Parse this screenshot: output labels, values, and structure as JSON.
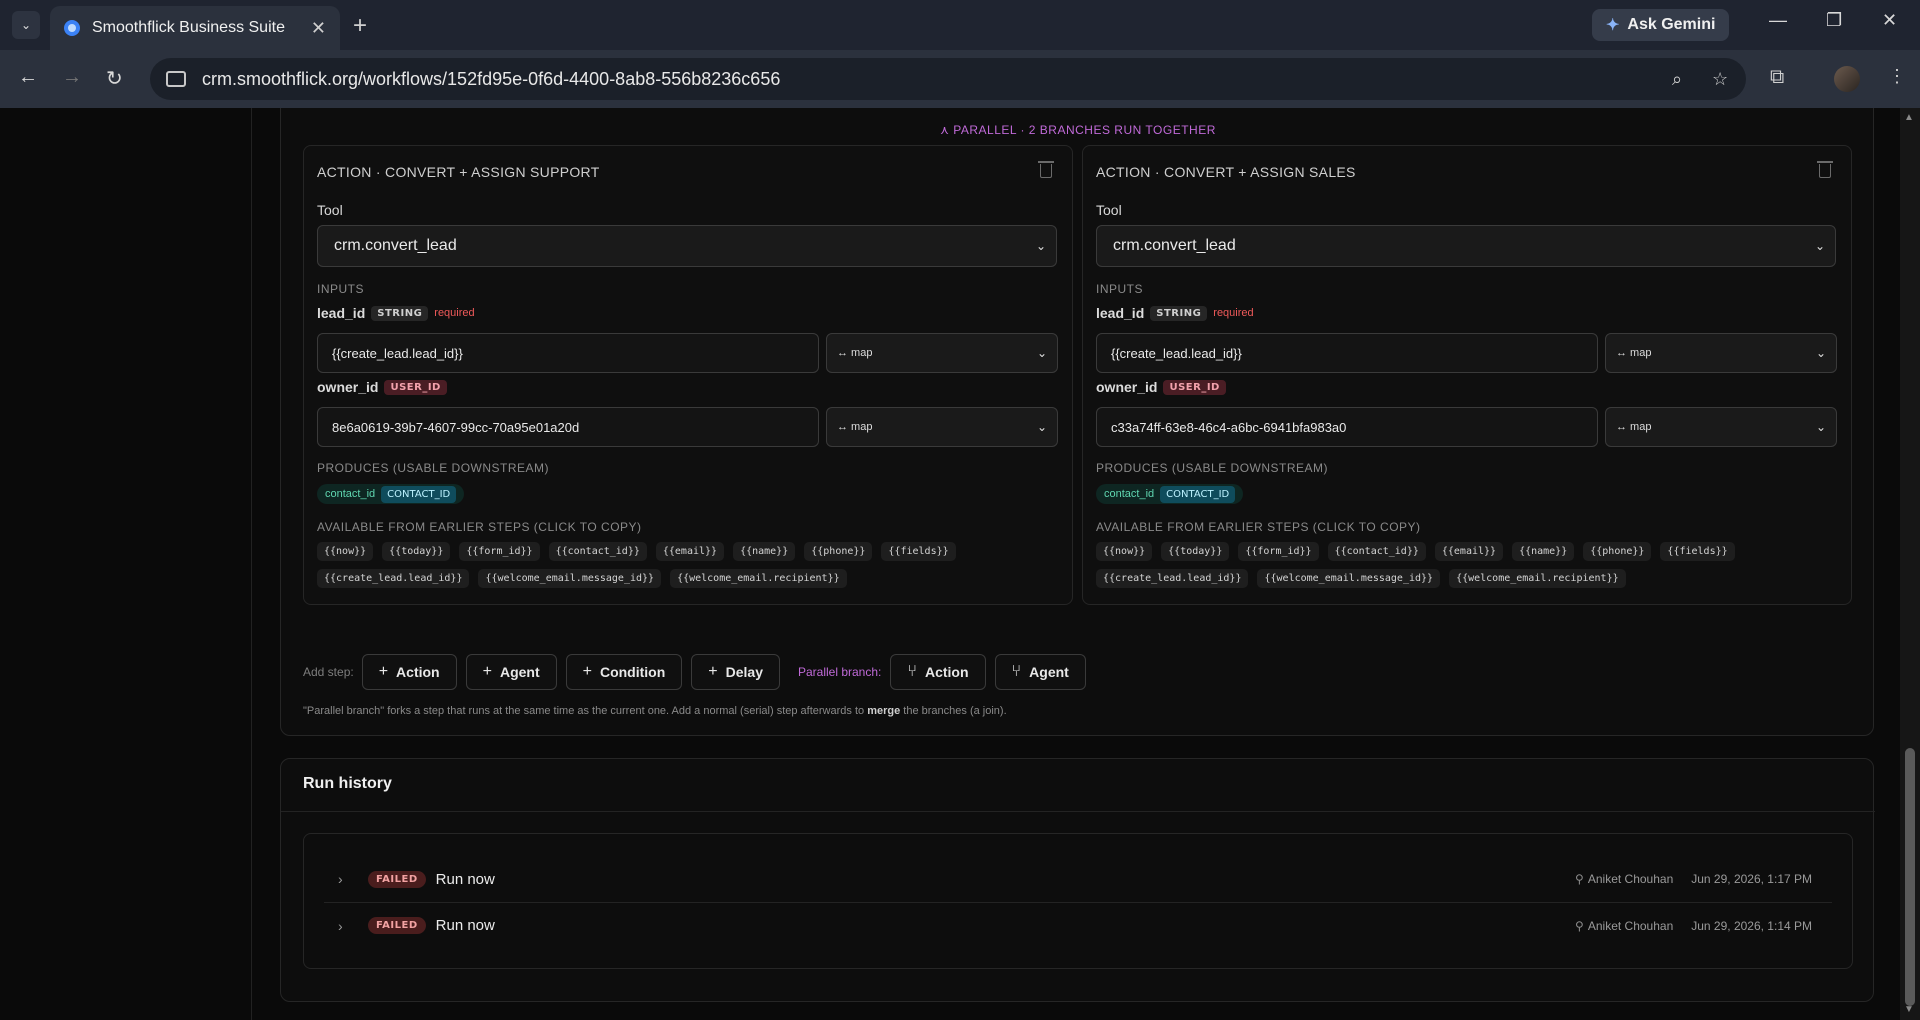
{
  "browser": {
    "tab_title": "Smoothflick Business Suite",
    "url": "crm.smoothflick.org/workflows/152fd95e-0f6d-4400-8ab8-556b8236c656",
    "gemini_label": "Ask Gemini"
  },
  "workflow": {
    "parallel_label": "⋏ PARALLEL · 2 BRANCHES RUN TOGETHER",
    "branches": [
      {
        "title": "ACTION · CONVERT + ASSIGN SUPPORT",
        "tool_label": "Tool",
        "tool_value": "crm.convert_lead",
        "inputs_label": "INPUTS",
        "lead_id": {
          "name": "lead_id",
          "type": "STRING",
          "required": "required",
          "value": "{{create_lead.lead_id}}",
          "mode": "↔ map"
        },
        "owner_id": {
          "name": "owner_id",
          "type": "USER_ID",
          "value": "8e6a0619-39b7-4607-99cc-70a95e01a20d",
          "mode": "↔ map"
        },
        "produces_label": "PRODUCES (USABLE DOWNSTREAM)",
        "produces_key": "contact_id",
        "produces_type": "CONTACT_ID",
        "available_label": "AVAILABLE FROM EARLIER STEPS (CLICK TO COPY)",
        "chips": [
          "{{now}}",
          "{{today}}",
          "{{form_id}}",
          "{{contact_id}}",
          "{{email}}",
          "{{name}}",
          "{{phone}}",
          "{{fields}}",
          "{{create_lead.lead_id}}",
          "{{welcome_email.message_id}}",
          "{{welcome_email.recipient}}"
        ]
      },
      {
        "title": "ACTION · CONVERT + ASSIGN SALES",
        "tool_label": "Tool",
        "tool_value": "crm.convert_lead",
        "inputs_label": "INPUTS",
        "lead_id": {
          "name": "lead_id",
          "type": "STRING",
          "required": "required",
          "value": "{{create_lead.lead_id}}",
          "mode": "↔ map"
        },
        "owner_id": {
          "name": "owner_id",
          "type": "USER_ID",
          "value": "c33a74ff-63e8-46c4-a6bc-6941bfa983a0",
          "mode": "↔ map"
        },
        "produces_label": "PRODUCES (USABLE DOWNSTREAM)",
        "produces_key": "contact_id",
        "produces_type": "CONTACT_ID",
        "available_label": "AVAILABLE FROM EARLIER STEPS (CLICK TO COPY)",
        "chips": [
          "{{now}}",
          "{{today}}",
          "{{form_id}}",
          "{{contact_id}}",
          "{{email}}",
          "{{name}}",
          "{{phone}}",
          "{{fields}}",
          "{{create_lead.lead_id}}",
          "{{welcome_email.message_id}}",
          "{{welcome_email.recipient}}"
        ]
      }
    ],
    "add_step_label": "Add step:",
    "add_buttons": [
      "Action",
      "Agent",
      "Condition",
      "Delay"
    ],
    "parallel_branch_label": "Parallel branch:",
    "parallel_buttons": [
      "Action",
      "Agent"
    ],
    "note_pre": "\"Parallel branch\" forks a step that runs at the same time as the current one. Add a normal (serial) step afterwards to ",
    "note_bold": "merge",
    "note_post": " the branches (a join)."
  },
  "run_history": {
    "title": "Run history",
    "runs": [
      {
        "status": "FAILED",
        "name": "Run now",
        "user": "Aniket Chouhan",
        "time": "Jun 29, 2026, 1:17 PM"
      },
      {
        "status": "FAILED",
        "name": "Run now",
        "user": "Aniket Chouhan",
        "time": "Jun 29, 2026, 1:14 PM"
      }
    ]
  }
}
